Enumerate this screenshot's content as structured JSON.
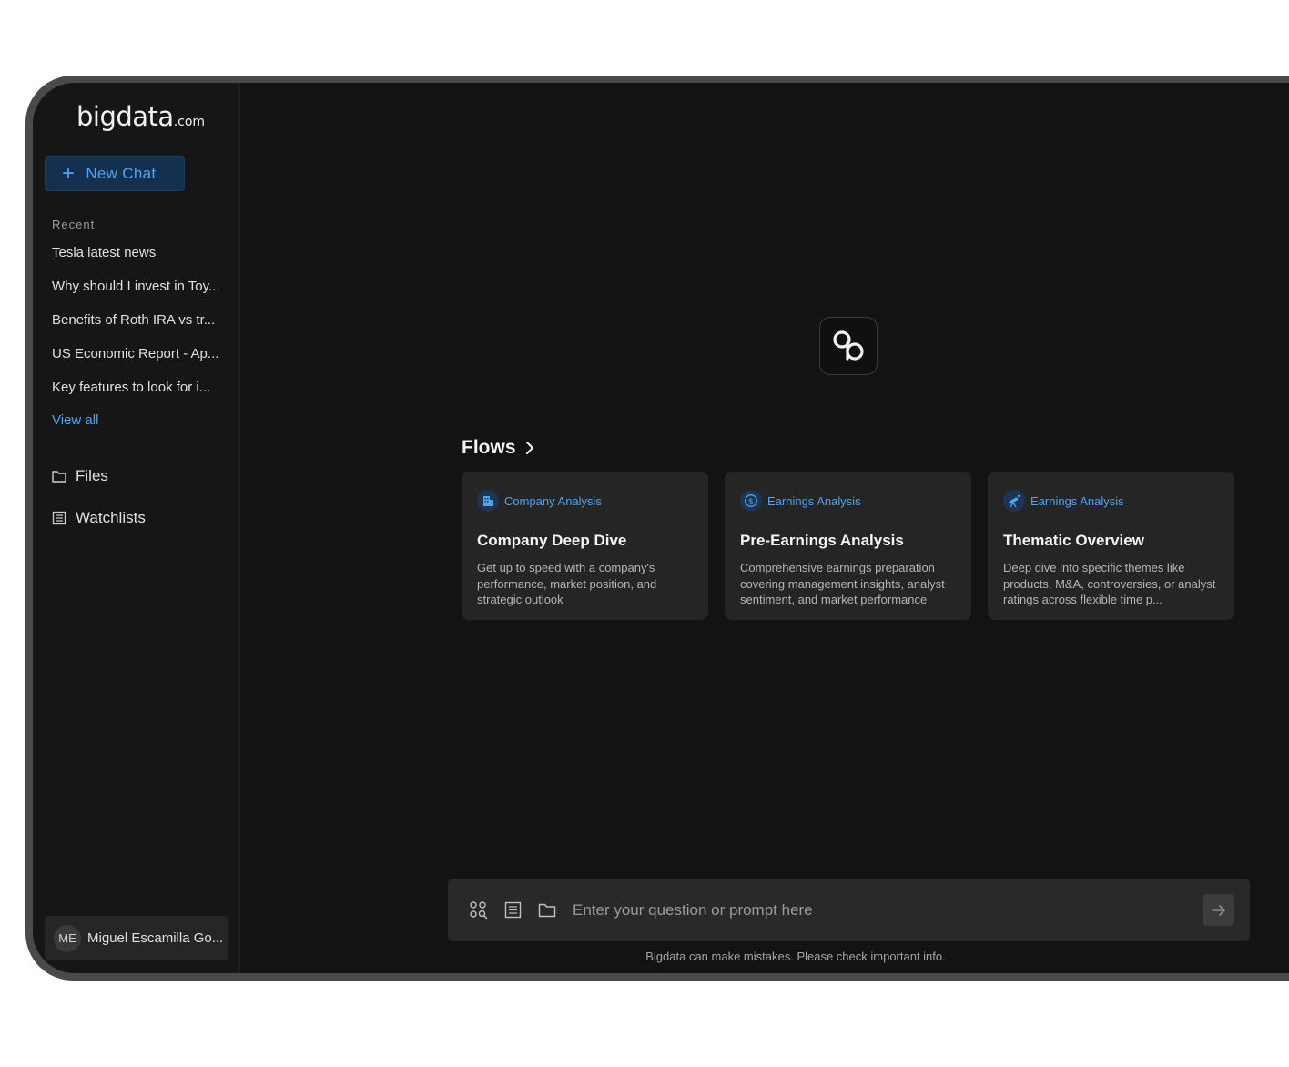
{
  "brand": {
    "name": "bigdata",
    "suffix": ".com"
  },
  "sidebar": {
    "new_chat_label": "New Chat",
    "recent_label": "Recent",
    "recent_items": [
      "Tesla latest news",
      "Why should I invest in Toy...",
      "Benefits of Roth IRA vs tr...",
      "US Economic Report - Ap...",
      "Key features to look for i..."
    ],
    "view_all_label": "View all",
    "nav": {
      "files": "Files",
      "watchlists": "Watchlists"
    },
    "user": {
      "initials": "ME",
      "name": "Miguel Escamilla Go..."
    }
  },
  "flows": {
    "title": "Flows",
    "cards": [
      {
        "category": "Company Analysis",
        "category_icon": "building-icon",
        "title": "Company Deep Dive",
        "description": "Get up to speed with a company's performance, market position, and strategic outlook"
      },
      {
        "category": "Earnings Analysis",
        "category_icon": "dollar-circle-icon",
        "title": "Pre-Earnings Analysis",
        "description": "Comprehensive earnings preparation covering management insights, analyst sentiment, and market performance"
      },
      {
        "category": "Earnings Analysis",
        "category_icon": "telescope-icon",
        "title": "Thematic Overview",
        "description": "Deep dive into specific themes like products, M&A, controversies, or analyst ratings across flexible time p..."
      }
    ]
  },
  "prompt": {
    "placeholder": "Enter your question or prompt here",
    "disclaimer": "Bigdata can make mistakes. Please check important info."
  },
  "colors": {
    "accent": "#4fa3f0",
    "background": "#131313",
    "sidebar": "#161616",
    "card": "#252525",
    "new_chat_bg": "#15304f"
  }
}
